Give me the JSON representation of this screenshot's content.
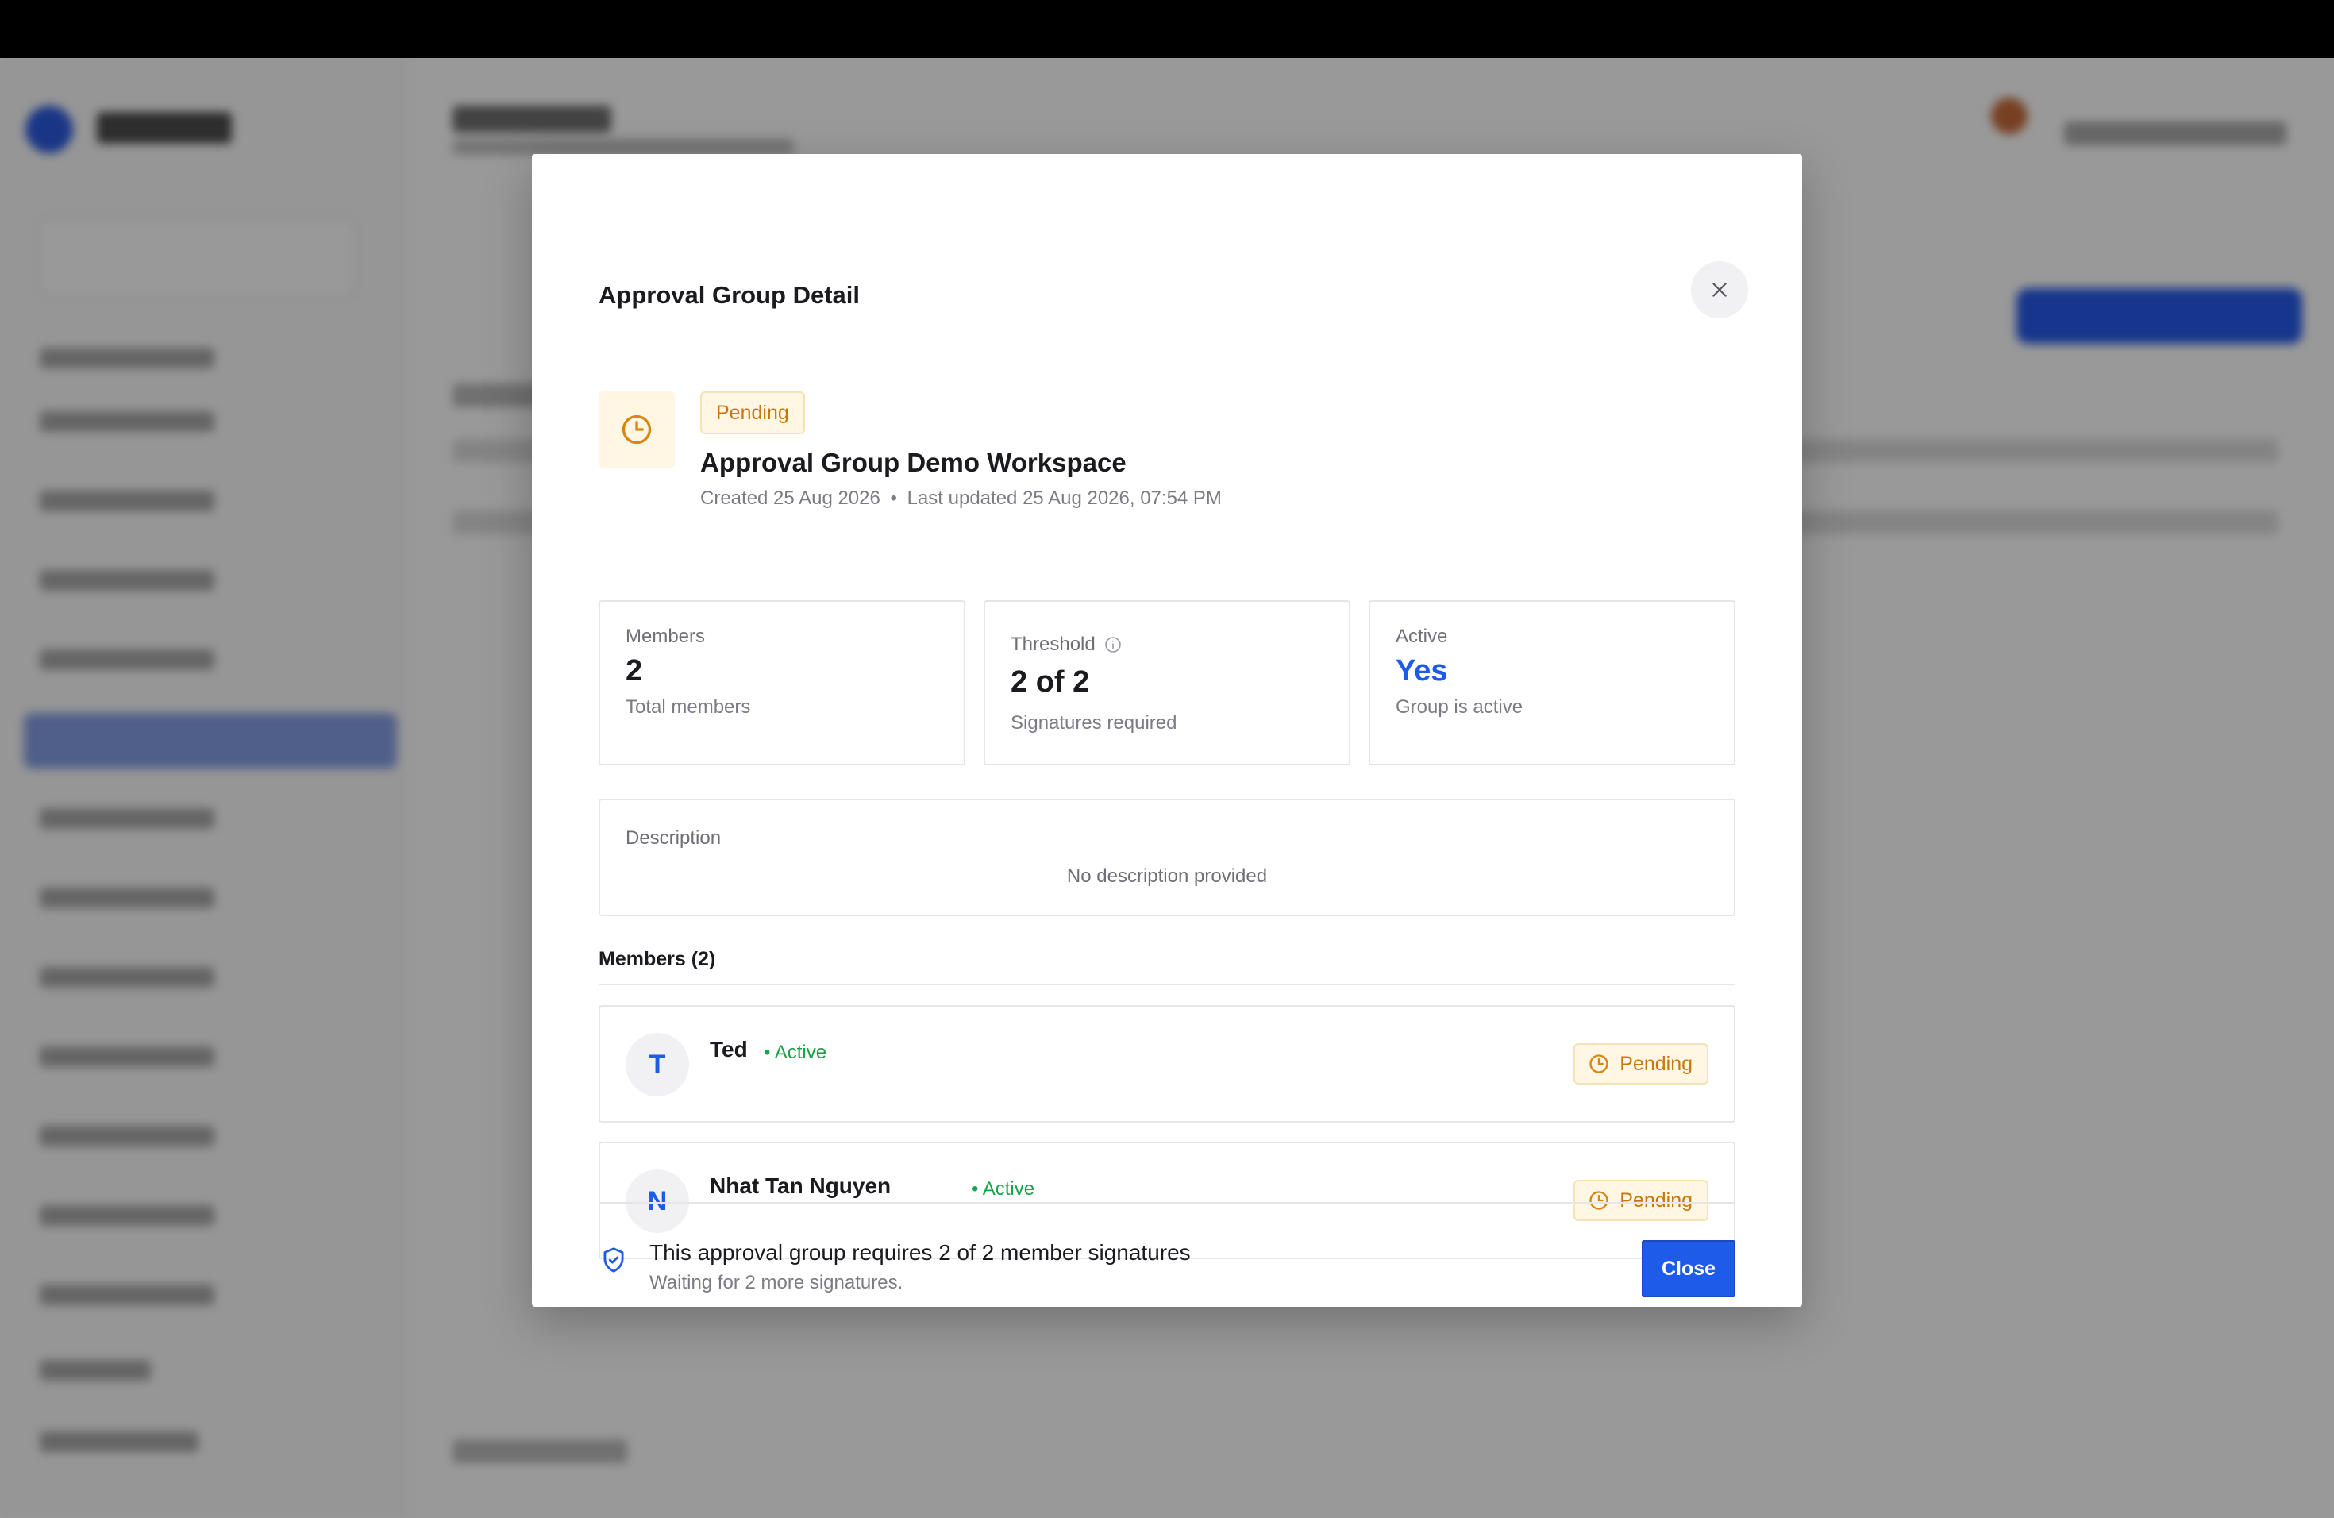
{
  "modal": {
    "title": "Approval Group Detail",
    "status_badge": "Pending",
    "group_name": "Approval Group Demo Workspace",
    "created": "Created 25 Aug 2026",
    "separator": "•",
    "last_updated": "Last updated 25 Aug 2026, 07:54 PM"
  },
  "stats": {
    "members": {
      "label": "Members",
      "value": "2",
      "sub": "Total members"
    },
    "threshold": {
      "label": "Threshold",
      "value": "2 of 2",
      "sub": "Signatures required"
    },
    "active": {
      "label": "Active",
      "value": "Yes",
      "sub": "Group is active"
    }
  },
  "description": {
    "label": "Description",
    "empty_text": "No description provided"
  },
  "members_section": {
    "title": "Members (2)",
    "items": [
      {
        "initial": "T",
        "name": "Ted",
        "status": "• Active",
        "approval": "Pending"
      },
      {
        "initial": "N",
        "name": "Nhat Tan Nguyen",
        "status": "• Active",
        "approval": "Pending"
      }
    ]
  },
  "footer": {
    "title": "This approval group requires 2 of 2 member signatures",
    "subtitle": "Waiting for 2 more signatures.",
    "close_label": "Close"
  },
  "colors": {
    "accent": "#1e5be8",
    "pending": "#c8780b",
    "pending_bg": "#fff6e3",
    "active_green": "#17a34a"
  }
}
